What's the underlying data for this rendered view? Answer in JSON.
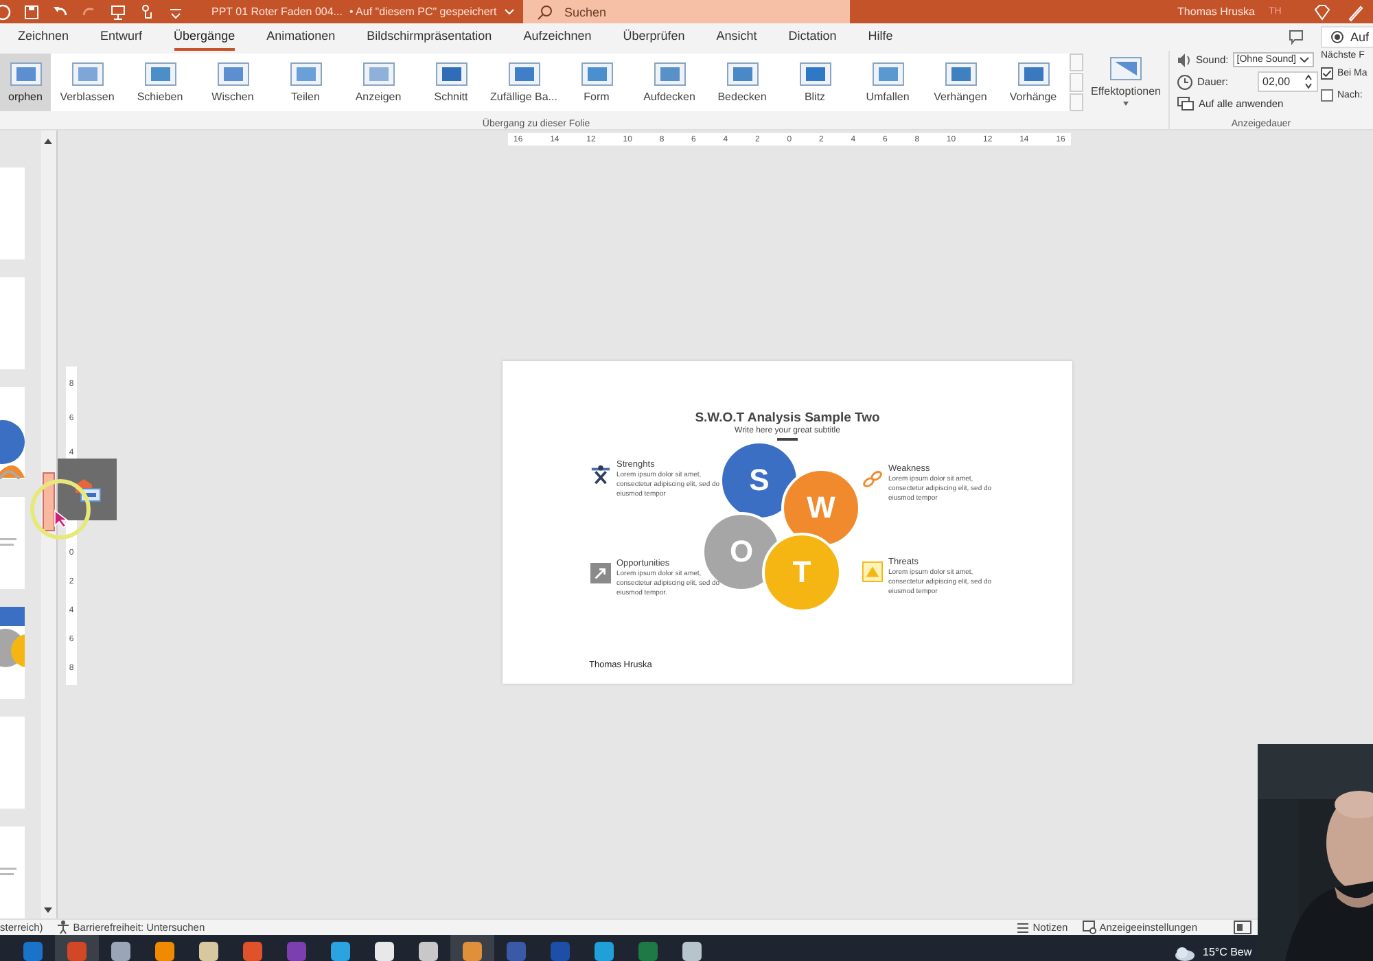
{
  "title_bar": {
    "title": "PPT 01 Roter Faden 004...",
    "save_status": "• Auf \"diesem PC\" gespeichert",
    "search": {
      "placeholder": "Suchen"
    },
    "user": "Thomas Hruska",
    "avatar": "TH"
  },
  "tabs": [
    {
      "label": "Zeichnen",
      "selected": false
    },
    {
      "label": "Entwurf",
      "selected": false
    },
    {
      "label": "Übergänge",
      "selected": true
    },
    {
      "label": "Animationen",
      "selected": false
    },
    {
      "label": "Bildschirmpräsentation",
      "selected": false
    },
    {
      "label": "Aufzeichnen",
      "selected": false
    },
    {
      "label": "Überprüfen",
      "selected": false
    },
    {
      "label": "Ansicht",
      "selected": false
    },
    {
      "label": "Dictation",
      "selected": false
    },
    {
      "label": "Hilfe",
      "selected": false
    }
  ],
  "record_button": "Auf",
  "transitions": [
    {
      "label": "orphen",
      "selected": true
    },
    {
      "label": "Verblassen",
      "selected": false
    },
    {
      "label": "Schieben",
      "selected": false
    },
    {
      "label": "Wischen",
      "selected": false
    },
    {
      "label": "Teilen",
      "selected": false
    },
    {
      "label": "Anzeigen",
      "selected": false
    },
    {
      "label": "Schnitt",
      "selected": false
    },
    {
      "label": "Zufällige Ba...",
      "selected": false
    },
    {
      "label": "Form",
      "selected": false
    },
    {
      "label": "Aufdecken",
      "selected": false
    },
    {
      "label": "Bedecken",
      "selected": false
    },
    {
      "label": "Blitz",
      "selected": false
    },
    {
      "label": "Umfallen",
      "selected": false
    },
    {
      "label": "Verhängen",
      "selected": false
    },
    {
      "label": "Vorhänge",
      "selected": false
    }
  ],
  "effect_options": "Effektoptionen",
  "transition_group_label": "Übergang zu dieser Folie",
  "timing": {
    "sound_label": "Sound:",
    "sound_value": "[Ohne Sound]",
    "duration_label": "Dauer:",
    "duration_value": "02,00",
    "apply_all": "Auf alle anwenden",
    "next_label": "Nächste F",
    "on_click": {
      "label": "Bei Ma",
      "checked": true
    },
    "after": {
      "label": "Nach:",
      "checked": false
    },
    "group_label": "Anzeigedauer"
  },
  "rulers": {
    "horizontal": [
      "16",
      "14",
      "12",
      "10",
      "8",
      "6",
      "4",
      "2",
      "0",
      "2",
      "4",
      "6",
      "8",
      "10",
      "12",
      "14",
      "16"
    ],
    "vertical": {
      "upper": [
        "8",
        "6",
        "4"
      ],
      "lower": [
        "0",
        "2",
        "4",
        "6",
        "8"
      ]
    }
  },
  "thumbnails": [
    {
      "kind": "blank"
    },
    {
      "kind": "blank"
    },
    {
      "kind": "circles-top"
    },
    {
      "kind": "text"
    },
    {
      "kind": "circles-bottom"
    },
    {
      "kind": "blank"
    },
    {
      "kind": "text"
    }
  ],
  "slide": {
    "title": "S.W.O.T Analysis Sample Two",
    "subtitle": "Write here your great subtitle",
    "circles": [
      {
        "letter": "S",
        "color": "#3a6fc4"
      },
      {
        "letter": "W",
        "color": "#f08a2c"
      },
      {
        "letter": "O",
        "color": "#a6a6a6"
      },
      {
        "letter": "T",
        "color": "#f5b614"
      }
    ],
    "quadrants": [
      {
        "kind": "strengths",
        "heading": "Strenghts",
        "body": "Lorem ipsum dolor sit amet, consectetur adipiscing elit, sed do eiusmod tempor"
      },
      {
        "kind": "weakness",
        "heading": "Weakness",
        "body": "Lorem ipsum dolor sit amet, consectetur adipiscing elit, sed do eiusmod tempor"
      },
      {
        "kind": "opportunities",
        "heading": "Opportunities",
        "body": "Lorem ipsum dolor sit amet, consectetur adipiscing elit, sed do eiusmod tempor."
      },
      {
        "kind": "threats",
        "heading": "Threats",
        "body": "Lorem ipsum dolor sit amet, consectetur adipiscing elit, sed do eiusmod tempor"
      }
    ],
    "author": "Thomas Hruska"
  },
  "status_bar": {
    "language": "sterreich)",
    "accessibility": "Barrierefreiheit: Untersuchen",
    "notes": "Notizen",
    "display_settings": "Anzeigeeinstellungen"
  },
  "taskbar": {
    "apps": [
      {
        "color": "#1a73c8",
        "selected": false
      },
      {
        "color": "#d24726",
        "selected": true
      },
      {
        "color": "#9aa6b8",
        "selected": false
      },
      {
        "color": "#f08a00",
        "selected": false
      },
      {
        "color": "#d8c8a0",
        "selected": false
      },
      {
        "color": "#e0522a",
        "selected": false
      },
      {
        "color": "#7b3fb0",
        "selected": false
      },
      {
        "color": "#2aa3e0",
        "selected": false
      },
      {
        "color": "#e8e8e8",
        "selected": false
      },
      {
        "color": "#c8c8c8",
        "selected": false
      },
      {
        "color": "#e0903a",
        "selected": true
      },
      {
        "color": "#3a5aa8",
        "selected": false
      },
      {
        "color": "#1e4fa8",
        "selected": false
      },
      {
        "color": "#1fa0d8",
        "selected": false
      },
      {
        "color": "#1d7a44",
        "selected": false
      },
      {
        "color": "#b8c4cc",
        "selected": false
      }
    ],
    "weather": "15°C Bew"
  }
}
